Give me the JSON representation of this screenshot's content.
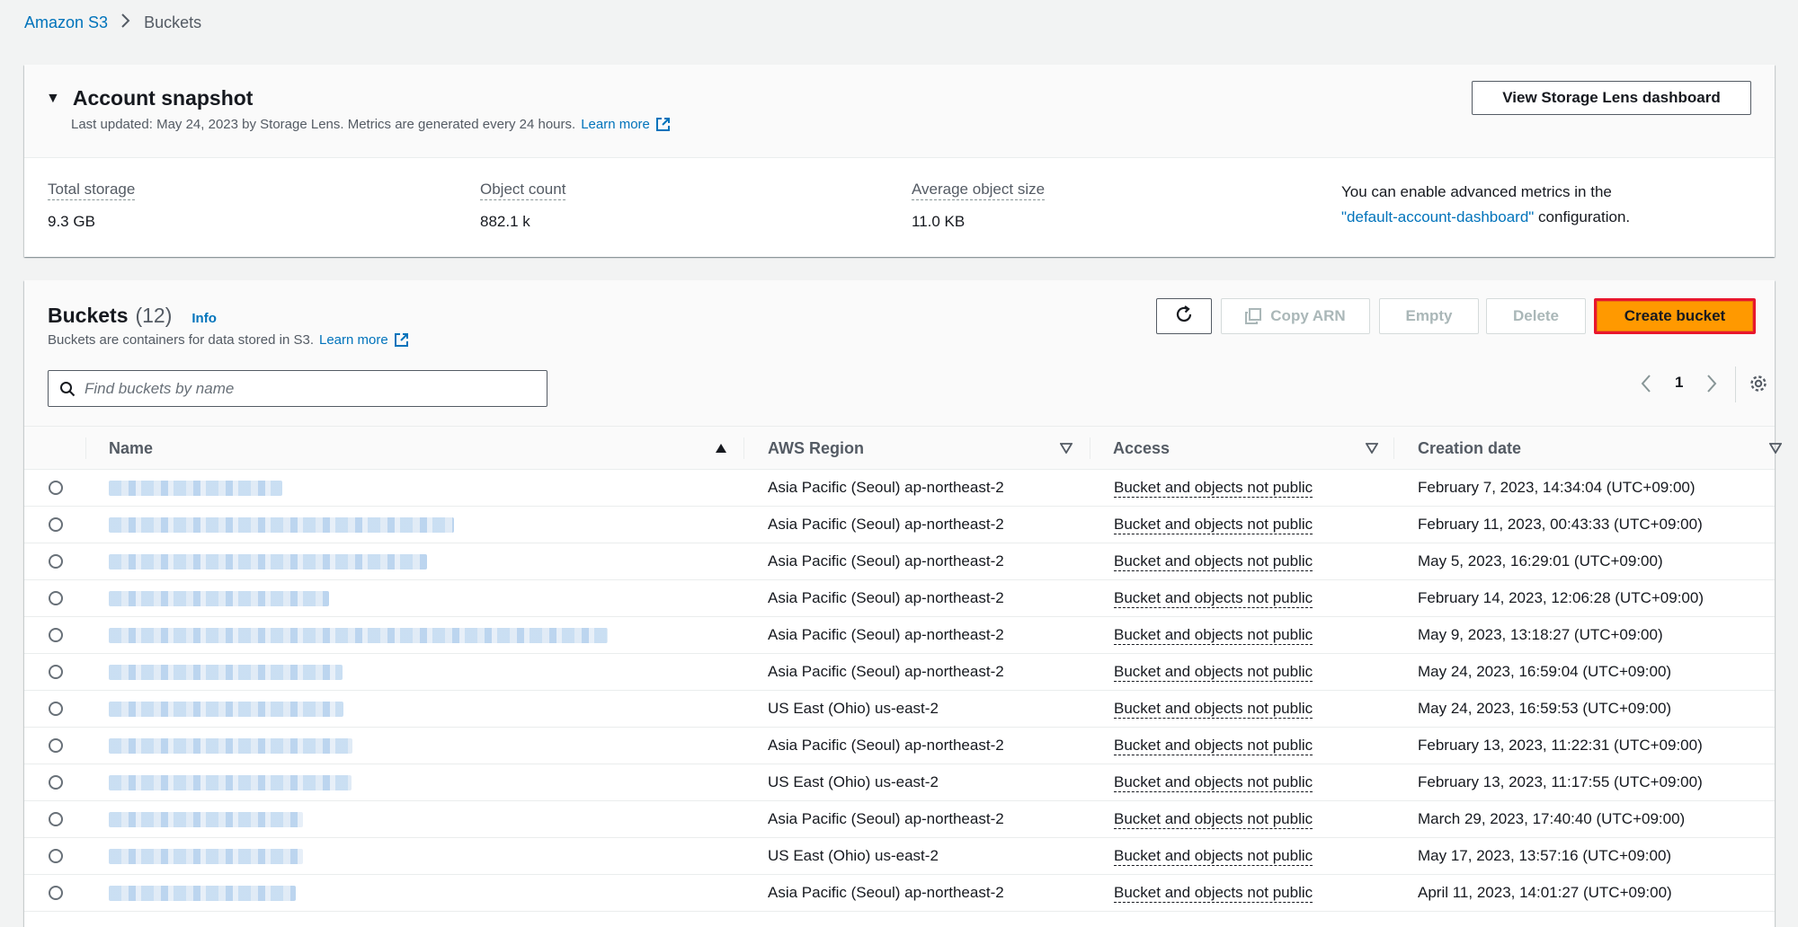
{
  "breadcrumb": {
    "root": "Amazon S3",
    "current": "Buckets"
  },
  "snapshot": {
    "title": "Account snapshot",
    "subtitle": "Last updated: May 24, 2023 by Storage Lens. Metrics are generated every 24 hours.",
    "learn_more": "Learn more",
    "lens_button": "View Storage Lens dashboard",
    "metrics": {
      "total_storage": {
        "label": "Total storage",
        "value": "9.3 GB"
      },
      "object_count": {
        "label": "Object count",
        "value": "882.1 k"
      },
      "avg_size": {
        "label": "Average object size",
        "value": "11.0 KB"
      }
    },
    "advanced": {
      "prefix": "You can enable advanced metrics in the",
      "link": "\"default-account-dashboard\"",
      "suffix": " configuration."
    }
  },
  "buckets": {
    "title": "Buckets",
    "count": "(12)",
    "info": "Info",
    "subtitle": "Buckets are containers for data stored in S3.",
    "learn_more": "Learn more",
    "copy_arn": "Copy ARN",
    "empty": "Empty",
    "delete": "Delete",
    "create": "Create bucket",
    "search_placeholder": "Find buckets by name",
    "page": "1",
    "columns": {
      "name": "Name",
      "region": "AWS Region",
      "access": "Access",
      "created": "Creation date"
    },
    "rows": [
      {
        "region": "Asia Pacific (Seoul) ap-northeast-2",
        "access": "Bucket and objects not public",
        "created": "February 7, 2023, 14:34:04 (UTC+09:00)"
      },
      {
        "region": "Asia Pacific (Seoul) ap-northeast-2",
        "access": "Bucket and objects not public",
        "created": "February 11, 2023, 00:43:33 (UTC+09:00)"
      },
      {
        "region": "Asia Pacific (Seoul) ap-northeast-2",
        "access": "Bucket and objects not public",
        "created": "May 5, 2023, 16:29:01 (UTC+09:00)"
      },
      {
        "region": "Asia Pacific (Seoul) ap-northeast-2",
        "access": "Bucket and objects not public",
        "created": "February 14, 2023, 12:06:28 (UTC+09:00)"
      },
      {
        "region": "Asia Pacific (Seoul) ap-northeast-2",
        "access": "Bucket and objects not public",
        "created": "May 9, 2023, 13:18:27 (UTC+09:00)"
      },
      {
        "region": "Asia Pacific (Seoul) ap-northeast-2",
        "access": "Bucket and objects not public",
        "created": "May 24, 2023, 16:59:04 (UTC+09:00)"
      },
      {
        "region": "US East (Ohio) us-east-2",
        "access": "Bucket and objects not public",
        "created": "May 24, 2023, 16:59:53 (UTC+09:00)"
      },
      {
        "region": "Asia Pacific (Seoul) ap-northeast-2",
        "access": "Bucket and objects not public",
        "created": "February 13, 2023, 11:22:31 (UTC+09:00)"
      },
      {
        "region": "US East (Ohio) us-east-2",
        "access": "Bucket and objects not public",
        "created": "February 13, 2023, 11:17:55 (UTC+09:00)"
      },
      {
        "region": "Asia Pacific (Seoul) ap-northeast-2",
        "access": "Bucket and objects not public",
        "created": "March 29, 2023, 17:40:40 (UTC+09:00)"
      },
      {
        "region": "US East (Ohio) us-east-2",
        "access": "Bucket and objects not public",
        "created": "May 17, 2023, 13:57:16 (UTC+09:00)"
      },
      {
        "region": "Asia Pacific (Seoul) ap-northeast-2",
        "access": "Bucket and objects not public",
        "created": "April 11, 2023, 14:01:27 (UTC+09:00)"
      }
    ]
  },
  "icons": {
    "breadcrumb_sep": "chevron-right-icon",
    "external": "external-link-icon",
    "refresh": "refresh-icon",
    "copy": "copy-icon",
    "search": "search-icon",
    "prev": "chevron-left-icon",
    "next": "chevron-right-icon",
    "settings": "gear-icon"
  },
  "colors": {
    "accent": "#ff9900",
    "link": "#0073bb",
    "highlight_border": "#e8172d"
  }
}
